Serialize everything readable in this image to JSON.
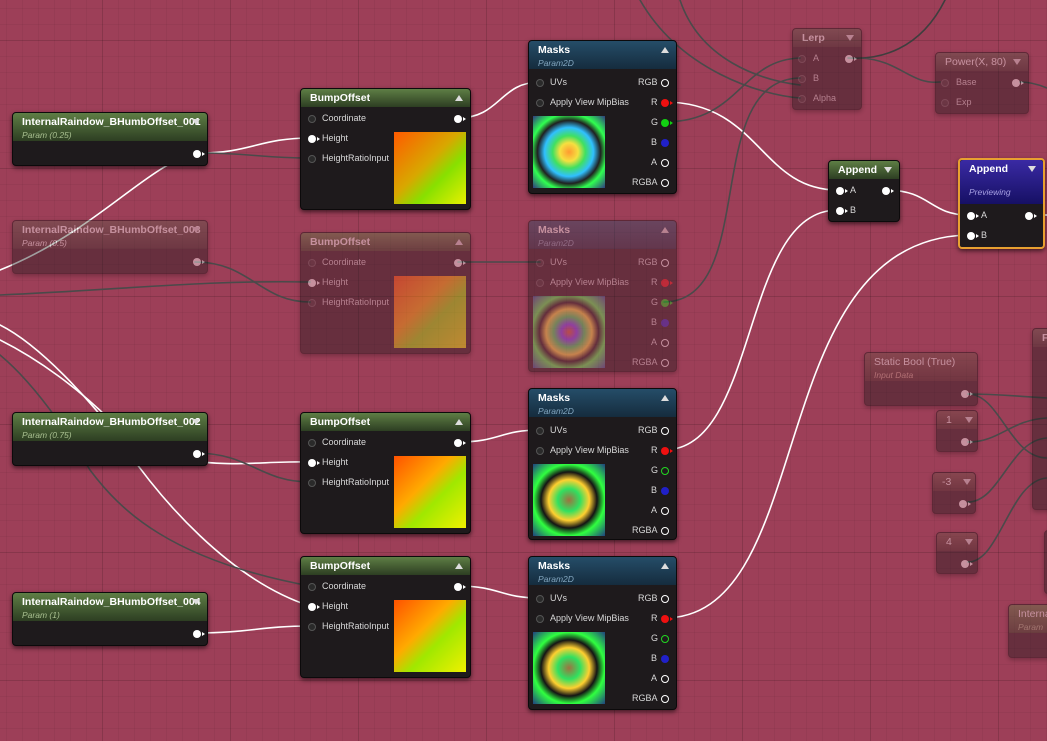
{
  "nodes": {
    "param001": {
      "title": "InternalRaindow_BHumbOffset_001",
      "sub": "Param (0.25)"
    },
    "param003": {
      "title": "InternalRaindow_BHumbOffset_003",
      "sub": "Param (0.5)"
    },
    "param002": {
      "title": "InternalRaindow_BHumbOffset_002",
      "sub": "Param (0.75)"
    },
    "param004": {
      "title": "InternalRaindow_BHumbOffset_004",
      "sub": "Param (1)"
    },
    "bump": {
      "title": "BumpOffset",
      "coordinate": "Coordinate",
      "height": "Height",
      "ratio": "HeightRatioInput"
    },
    "masks": {
      "title": "Masks",
      "sub": "Param2D",
      "uvs": "UVs",
      "mip": "Apply View MipBias",
      "rgb": "RGB",
      "r": "R",
      "g": "G",
      "b": "B",
      "a": "A",
      "rgba": "RGBA"
    },
    "lerp": {
      "title": "Lerp",
      "a": "A",
      "b": "B",
      "alpha": "Alpha"
    },
    "power": {
      "title": "Power(X, 80)",
      "base": "Base",
      "exp": "Exp"
    },
    "append1": {
      "title": "Append",
      "a": "A",
      "b": "B"
    },
    "append2": {
      "title": "Append",
      "sub": "Previewing",
      "a": "A",
      "b": "B"
    },
    "staticbool": {
      "title": "Static Bool (True)",
      "sub": "Input Data"
    },
    "const1": "1",
    "const2": "-3",
    "const3": "4",
    "partial_right_top": "F",
    "partial_right_bottom": {
      "title": "Interna",
      "sub": "Param"
    }
  },
  "colors": {
    "background": "#9d3f58",
    "param_header": "#5e7e45",
    "masks_header": "#254d68",
    "append_preview": "#3a2aa4",
    "selection_border": "#e8a030",
    "pin_red": "#ee1010",
    "pin_green": "#12d012",
    "pin_blue": "#2020c8"
  }
}
